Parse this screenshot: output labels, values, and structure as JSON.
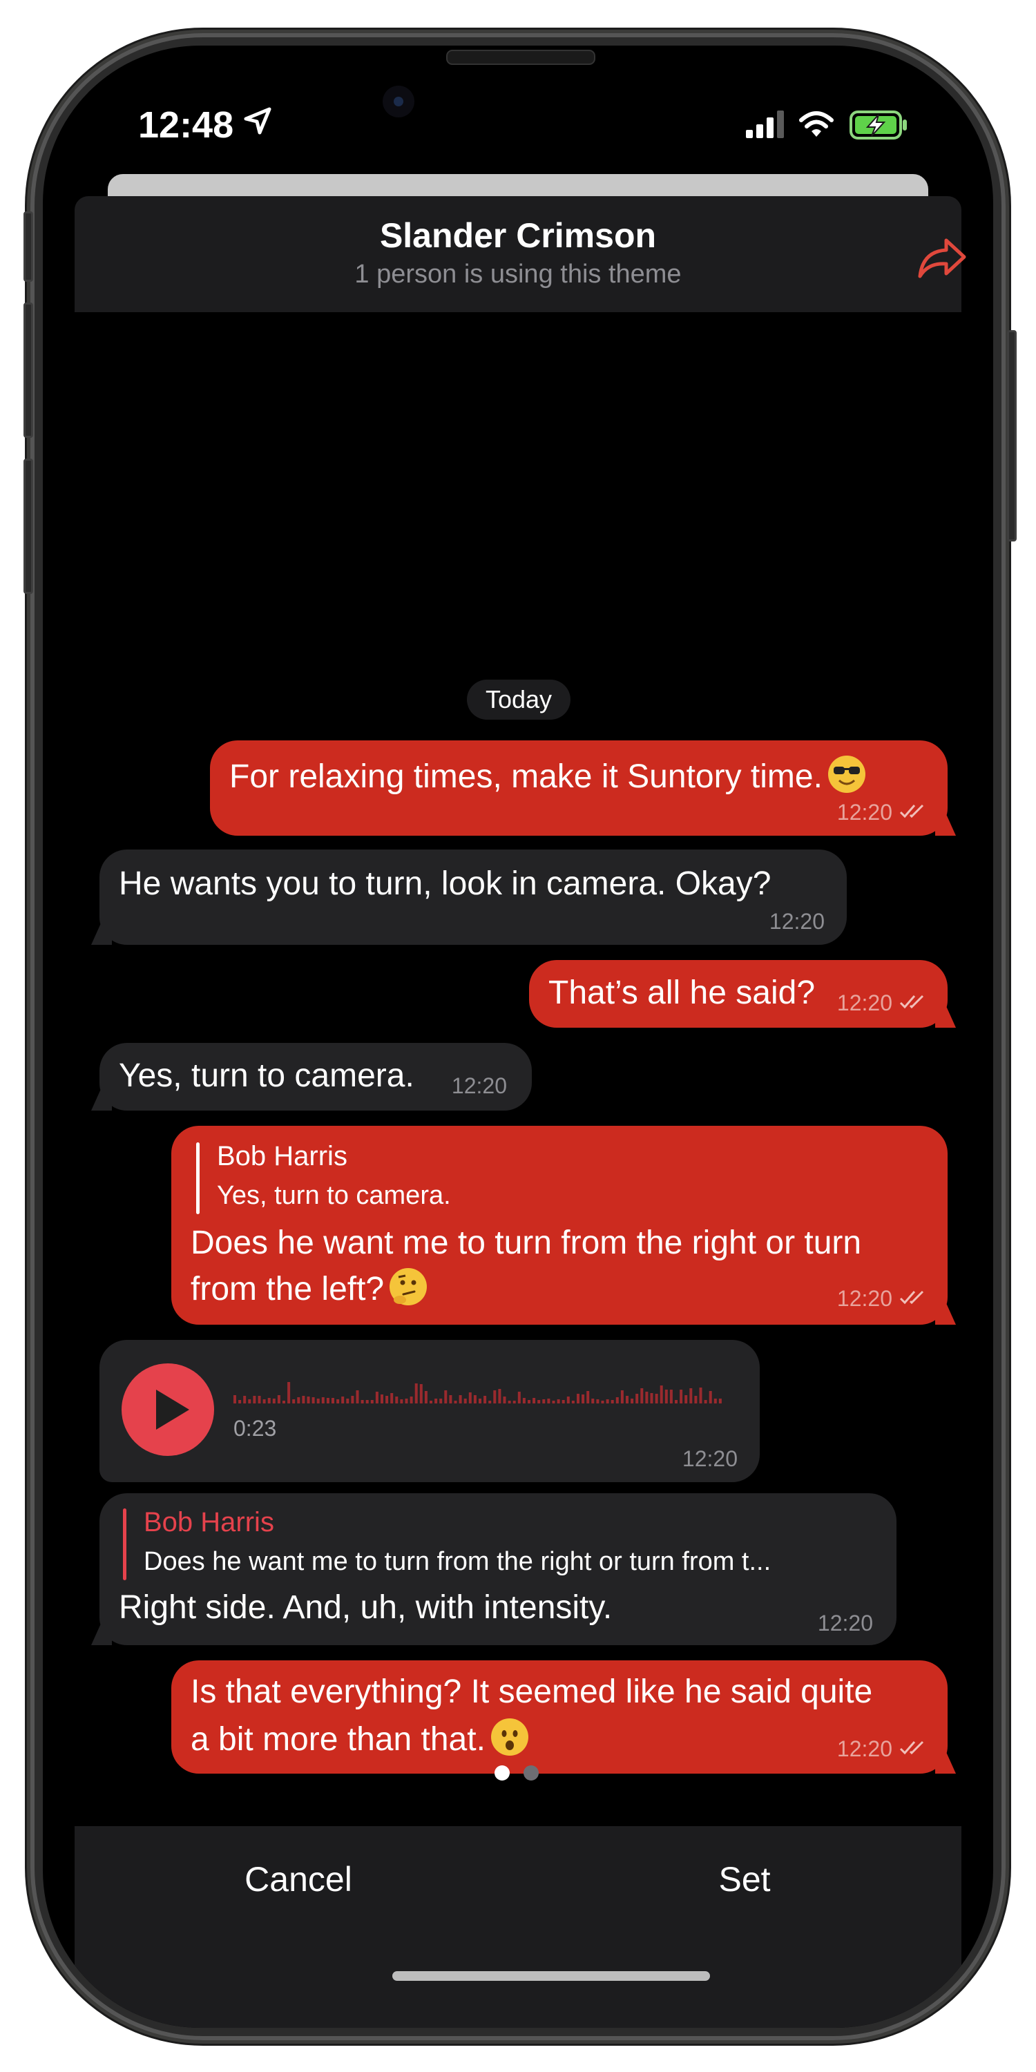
{
  "status_bar": {
    "time": "12:48"
  },
  "header": {
    "title": "Slander Crimson",
    "subtitle": "1 person is using this theme"
  },
  "chat": {
    "date_label": "Today",
    "messages": [
      {
        "dir": "out",
        "text": "For relaxing times, make it Suntory time.",
        "emoji": "sunglasses",
        "time": "12:20"
      },
      {
        "dir": "in",
        "text": "He wants you to turn, look in camera. Okay?",
        "time": "12:20"
      },
      {
        "dir": "out",
        "text": "That’s all he said?",
        "time": "12:20"
      },
      {
        "dir": "in",
        "text": "Yes, turn to camera.",
        "time": "12:20"
      },
      {
        "dir": "out",
        "reply_name": "Bob Harris",
        "reply_text": "Yes, turn to camera.",
        "text_line1": "Does he want me to turn from the right or turn",
        "text_line2": "from the left?",
        "emoji": "thinking",
        "time": "12:20"
      },
      {
        "dir": "in",
        "type": "voice",
        "duration": "0:23",
        "time": "12:20"
      },
      {
        "dir": "in",
        "reply_name": "Bob Harris",
        "reply_text": "Does he want me to turn from the right or turn from t...",
        "text": "Right side. And, uh, with intensity.",
        "time": "12:20"
      },
      {
        "dir": "out",
        "text_line1": "Is that everything? It seemed like he said quite",
        "text_line2": "a bit more than that.",
        "emoji": "hushed",
        "time": "12:20"
      }
    ]
  },
  "pager": {
    "total": 2,
    "active": 0
  },
  "buttons": {
    "cancel": "Cancel",
    "set": "Set"
  },
  "colors": {
    "accent": "#cc2b1f",
    "incoming_bubble": "#232325",
    "reply_accent": "#e5424c",
    "background": "#000000"
  },
  "icons": [
    "location-arrow-icon",
    "signal-icon",
    "wifi-icon",
    "battery-charging-icon",
    "share-icon",
    "read-check-icon",
    "play-icon"
  ]
}
